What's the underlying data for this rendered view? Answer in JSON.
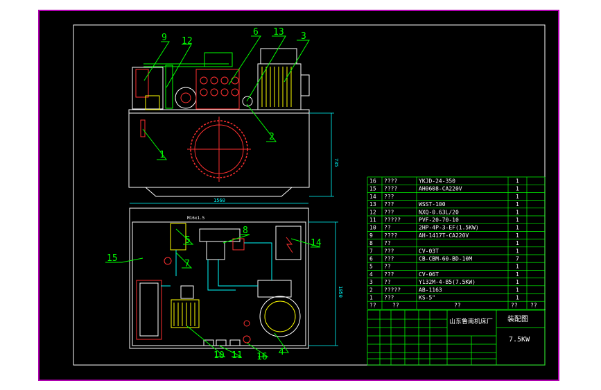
{
  "sheet": {
    "background": "#000000",
    "page_color": "#ffffff",
    "border_color": "#b000b0",
    "frame_color": "#ffffff",
    "callout_color": "#00ff00",
    "dim_color": "#00ffff",
    "table_color": "#00ff00",
    "text_color": "#ffffff"
  },
  "callouts": [
    "9",
    "12",
    "6",
    "13",
    "3",
    "1",
    "2",
    "5",
    "7",
    "8",
    "14",
    "15",
    "10",
    "11",
    "16",
    "4"
  ],
  "dims": {
    "top_height": "735",
    "plan_width": "1560",
    "plan_depth": "1050",
    "port_label": "M16x1.5"
  },
  "bom": [
    {
      "no": "16",
      "name": "????",
      "spec": "YKJD-24-350",
      "qty": "1"
    },
    {
      "no": "15",
      "name": "????",
      "spec": "AH0608-CA220V",
      "qty": "1"
    },
    {
      "no": "14",
      "name": "???",
      "spec": "",
      "qty": "1"
    },
    {
      "no": "13",
      "name": "???",
      "spec": "WSST-100",
      "qty": "1"
    },
    {
      "no": "12",
      "name": "???",
      "spec": "NXQ-0.63L/20",
      "qty": "1"
    },
    {
      "no": "11",
      "name": "?????",
      "spec": "PVF-20-70-10",
      "qty": "1"
    },
    {
      "no": "10",
      "name": "??",
      "spec": "2HP-4P-3-EF(1.5KW)",
      "qty": "1"
    },
    {
      "no": "9",
      "name": "????",
      "spec": "AH-1417T-CA220V",
      "qty": "1"
    },
    {
      "no": "8",
      "name": "??",
      "spec": "",
      "qty": "1"
    },
    {
      "no": "7",
      "name": "???",
      "spec": "CV-03T",
      "qty": "1"
    },
    {
      "no": "6",
      "name": "???",
      "spec": "CB-CBM-60-BD-10M",
      "qty": "7"
    },
    {
      "no": "5",
      "name": "??",
      "spec": "",
      "qty": "1"
    },
    {
      "no": "4",
      "name": "???",
      "spec": "CV-06T",
      "qty": "1"
    },
    {
      "no": "3",
      "name": "??",
      "spec": "Y132M-4-B5(7.5KW)",
      "qty": "1"
    },
    {
      "no": "2",
      "name": "?????",
      "spec": "AB-1163",
      "qty": "1"
    },
    {
      "no": "1",
      "name": "???",
      "spec": "KS-5\"",
      "qty": "1"
    }
  ],
  "bom_header": {
    "no": "??",
    "name": "??",
    "spec": "??",
    "qty": "??",
    "note": "??"
  },
  "title_block": {
    "company": "山东鲁南机床厂",
    "drawing_name": "装配图",
    "model": "7.5KW"
  }
}
